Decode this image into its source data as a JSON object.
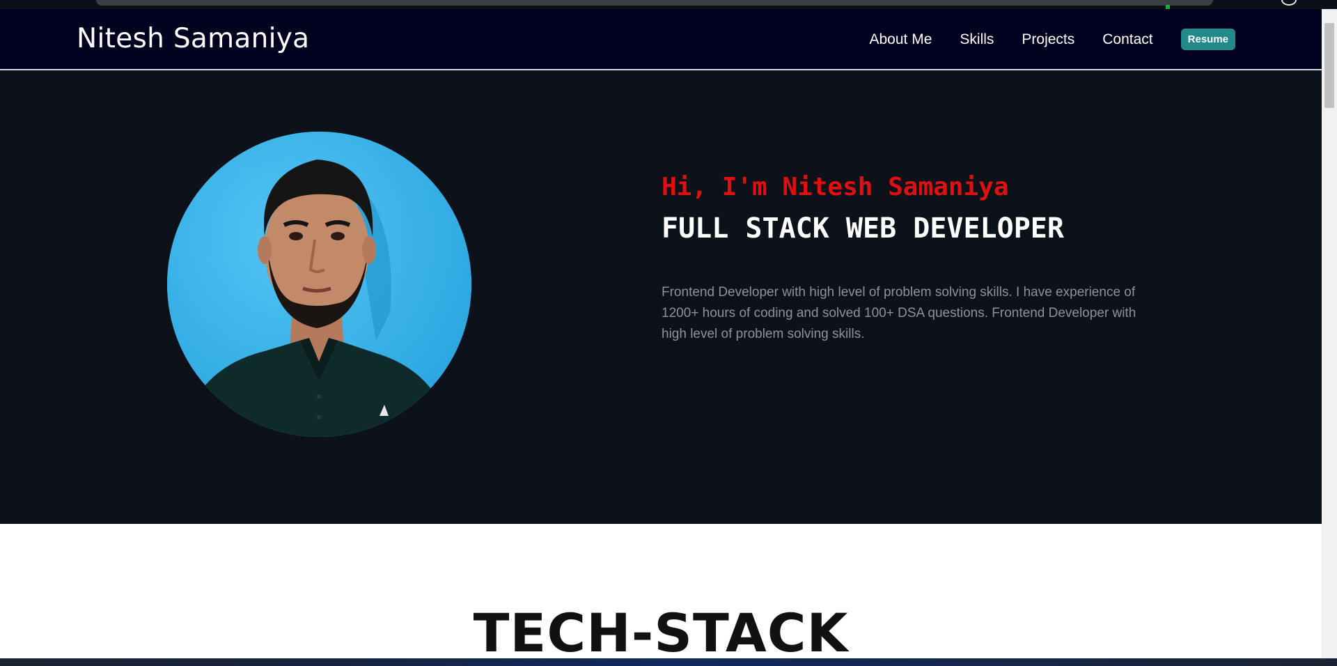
{
  "navbar": {
    "brand": "Nitesh Samaniya",
    "links": [
      "About Me",
      "Skills",
      "Projects",
      "Contact"
    ],
    "resume_label": "Resume",
    "background": "#01011f",
    "resume_color": "#238a8c"
  },
  "hero": {
    "greeting": "Hi, I'm Nitesh Samaniya",
    "role": "FULL STACK WEB DEVELOPER",
    "bio": "Frontend Developer with high level of problem solving skills. I have experience of 1200+ hours of coding and solved 100+ DSA questions. Frontend Developer with high level of problem solving skills.",
    "greeting_color": "#e01010",
    "background": "#0d111a",
    "avatar_background": "#3bb6ec"
  },
  "tech_stack": {
    "title": "TECH-STACK"
  }
}
